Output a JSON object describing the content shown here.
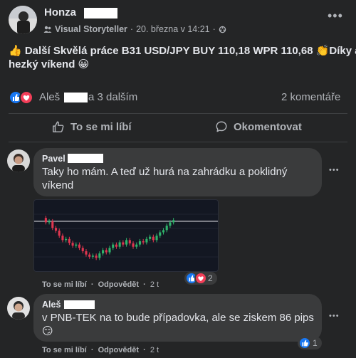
{
  "post": {
    "author": "Honza",
    "group": "Visual Storyteller",
    "separator": "·",
    "date": "20. března v 14:21",
    "separator2": "·",
    "text_line1": "👍 Další Skvělá práce B31 USD/JPY BUY 110,18 WPR 110,68 👏Díky a",
    "text_line2": "hezký víkend 😀",
    "reactions_name": "Aleš",
    "reactions_rest": "a 3 dalším",
    "comments_count": "2 komentáře"
  },
  "actions": {
    "like": "To se mi líbí",
    "comment": "Okomentovat"
  },
  "comments": [
    {
      "author": "Pavel",
      "text_line1": "Taky ho mám. A teď už hurá na zahrádku a poklidný",
      "text_line2": "víkend",
      "like": "To se mi líbí",
      "reply": "Odpovědět",
      "time": "2 t",
      "sep": "·",
      "reaction_count": "2",
      "more": "•••"
    },
    {
      "author": "Aleš",
      "text_line1": "v PNB-TEK na to bude případovka, ale se ziskem 86 pips",
      "text_line2": "😏",
      "like": "To se mi líbí",
      "reply": "Odpovědět",
      "time": "2 t",
      "sep": "·",
      "reaction_count": "1",
      "more": "•••"
    }
  ],
  "post_more": "•••",
  "colors": {
    "bg": "#242526",
    "bubble": "#3a3b3c",
    "like_blue": "#1877f2",
    "love_red": "#f33e58",
    "candle_up": "#2fb36b",
    "candle_down": "#e0364f"
  },
  "chart_data": {
    "type": "candlestick",
    "note_values": "approximate relative price levels 0-100 read from thumbnail",
    "candles": [
      [
        78,
        70
      ],
      [
        70,
        72
      ],
      [
        72,
        60
      ],
      [
        60,
        55
      ],
      [
        55,
        46
      ],
      [
        46,
        38
      ],
      [
        38,
        40
      ],
      [
        40,
        33
      ],
      [
        33,
        28
      ],
      [
        28,
        30
      ],
      [
        30,
        24
      ],
      [
        24,
        18
      ],
      [
        18,
        12
      ],
      [
        12,
        8
      ],
      [
        8,
        10
      ],
      [
        10,
        6
      ],
      [
        6,
        14
      ],
      [
        14,
        20
      ],
      [
        20,
        16
      ],
      [
        16,
        24
      ],
      [
        24,
        30
      ],
      [
        30,
        26
      ],
      [
        26,
        34
      ],
      [
        34,
        30
      ],
      [
        30,
        38
      ],
      [
        38,
        32
      ],
      [
        32,
        26
      ],
      [
        26,
        30
      ],
      [
        30,
        36
      ],
      [
        36,
        34
      ],
      [
        34,
        40
      ],
      [
        40,
        44
      ],
      [
        44,
        38
      ],
      [
        38,
        46
      ],
      [
        46,
        52
      ],
      [
        52,
        56
      ],
      [
        56,
        64
      ],
      [
        64,
        70
      ],
      [
        70,
        74
      ]
    ],
    "hline_level": 72
  }
}
